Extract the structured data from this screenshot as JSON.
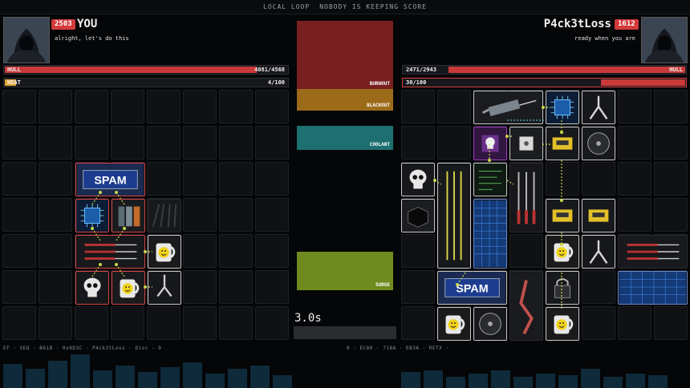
{
  "top_bar": {
    "left": "LOCAL LOOP",
    "right": "NOBODY IS KEEPING SCORE"
  },
  "player": {
    "score": "2503",
    "name": "YOU",
    "quote": "alright, let's do this",
    "hull_label": "HULL",
    "hull_value": "4081/4568",
    "hull_fraction": 0.893,
    "heat_label": "HEAT",
    "heat_value": "4/100",
    "heat_fraction": 0.04
  },
  "opponent": {
    "score": "1612",
    "name": "P4ck3tLoss",
    "quote": "ready when you are",
    "hull_label": "HULL",
    "hull_value": "2471/2943",
    "hull_fraction": 0.84,
    "heat_label": "HEAT",
    "heat_value": "30/100",
    "heat_fraction": 0.3
  },
  "zones": {
    "burnout": "BURNOUT",
    "blackout": "BLACKOUT",
    "coolant": "COOLANT",
    "surge": "SURGE"
  },
  "timer": "3.0s",
  "colors": {
    "burnout": "#7a1f1f",
    "blackout": "#9c6b1a",
    "coolant": "#1e6f72",
    "surge": "#6f8a1f",
    "accent_red": "#d43a3a"
  },
  "items": {
    "spam_label": "SPAM",
    "spam_label_opp": "SPAM"
  },
  "footer": {
    "left": "EF · SEQ · B61B · 0x9D3C · P4ck3tLoss · Disc - 9",
    "right": "0 · EC80 · 718A · EB3A · RETX ·"
  }
}
